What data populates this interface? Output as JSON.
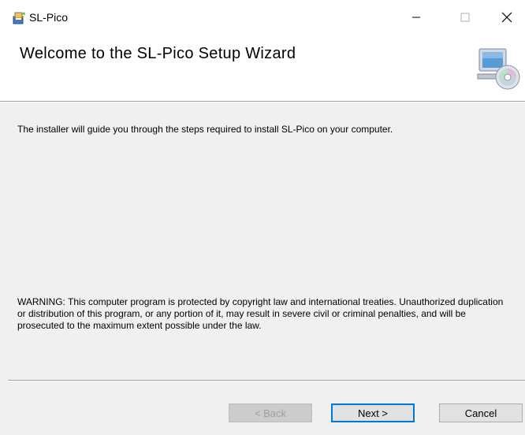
{
  "window": {
    "title": "SL-Pico",
    "minimize_glyph": "—",
    "maximize_glyph": "☐",
    "close_glyph": "✕"
  },
  "header": {
    "title": "Welcome to the SL-Pico Setup Wizard",
    "graphic_icon": "computer-cd-icon"
  },
  "content": {
    "intro": "The installer will guide you through the steps required to install SL-Pico on your computer.",
    "warning": "WARNING: This computer program is protected by copyright law and international treaties. Unauthorized duplication or distribution of this program, or any portion of it, may result in severe civil or criminal penalties, and will be prosecuted to the maximum extent possible under the law."
  },
  "buttons": {
    "back_label": "< Back",
    "next_label": "Next >",
    "cancel_label": "Cancel"
  },
  "colors": {
    "window_bg": "#f0f0f0",
    "header_bg": "#ffffff",
    "accent": "#0078d7",
    "disabled_text": "#a0a0a0"
  }
}
